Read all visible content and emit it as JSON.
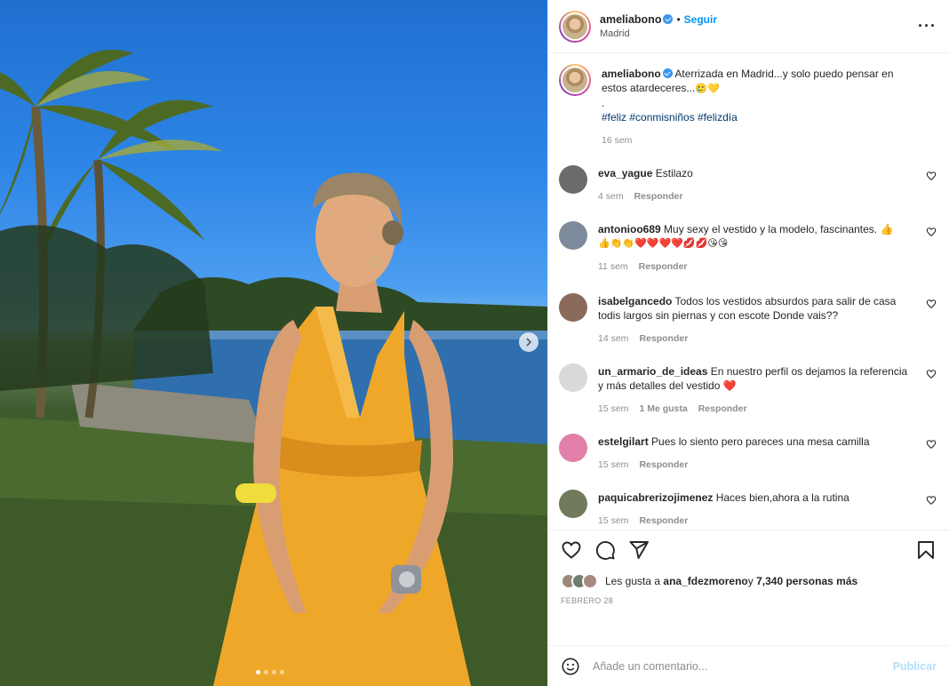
{
  "post": {
    "username": "ameliabono",
    "follow_label": "Seguir",
    "location": "Madrid",
    "media": {
      "slide_count": 4,
      "active_slide": 1
    }
  },
  "caption": {
    "username": "ameliabono",
    "text": "Aterrizada en Madrid...y solo puedo pensar en estos atardeceres...",
    "emojis": "🥲💛",
    "line2": ".",
    "hashtags": "#feliz #conmisniños #felizdía",
    "time": "16 sem"
  },
  "comments": [
    {
      "username": "eva_yague",
      "text": "Estilazo",
      "time": "4 sem",
      "likes": "",
      "reply": "Responder",
      "avatar_color": "#6b6b6b"
    },
    {
      "username": "antonioo689",
      "text": "Muy sexy el vestido y la modelo, fascinantes. 👍",
      "line2": "👍👏👏❤️❤️❤️❤️💋💋😘😘",
      "time": "11 sem",
      "likes": "",
      "reply": "Responder",
      "avatar_color": "#7d8a9c"
    },
    {
      "username": "isabelgancedo",
      "text": "Todos los vestidos absurdos para salir de casa todis largos sin piernas y con escote Donde vais??",
      "time": "14 sem",
      "likes": "",
      "reply": "Responder",
      "avatar_color": "#8a6a5a"
    },
    {
      "username": "un_armario_de_ideas",
      "text": "En nuestro perfil os dejamos la referencia y más detalles del vestido ❤️",
      "time": "15 sem",
      "likes": "1 Me gusta",
      "reply": "Responder",
      "avatar_color": "#d9d9d9"
    },
    {
      "username": "estelgilart",
      "text": "Pues lo siento pero pareces una mesa camilla",
      "time": "15 sem",
      "likes": "",
      "reply": "Responder",
      "avatar_color": "#e07fa8"
    },
    {
      "username": "paquicabrerizojimenez",
      "text": "Haces bien,ahora a la rutina",
      "time": "15 sem",
      "likes": "",
      "reply": "Responder",
      "avatar_color": "#6f7b5a"
    }
  ],
  "likes": {
    "prefix": "Les gusta a ",
    "user": "ana_fdezmoreno",
    "connector": " y ",
    "others": "7,340 personas más"
  },
  "date": "FEBRERO 28",
  "add_comment": {
    "placeholder": "Añade un comentario...",
    "publish_label": "Publicar"
  },
  "icons": {
    "like": "heart-icon",
    "comment": "comment-icon",
    "share": "share-icon",
    "save": "bookmark-icon",
    "more": "more-icon",
    "emoji": "emoji-icon",
    "next": "chevron-right-icon",
    "verified": "verified-badge-icon"
  },
  "colors": {
    "link": "#0095f6",
    "hashtag": "#00376b",
    "muted": "#8e8e8e",
    "publish_disabled": "#b2dffc",
    "verified": "#3897f0"
  }
}
